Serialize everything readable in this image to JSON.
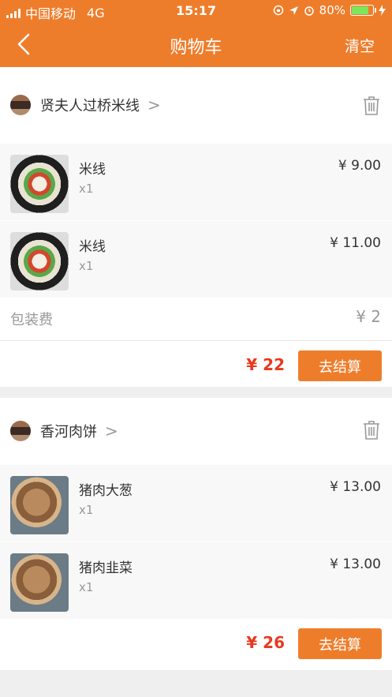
{
  "status_bar": {
    "carrier": "中国移动",
    "network": "4G",
    "time": "15:17",
    "battery": "80%",
    "battery_level": 0.8
  },
  "nav": {
    "title": "购物车",
    "clear_label": "清空"
  },
  "shops": [
    {
      "name": "贤夫人过桥米线",
      "items": [
        {
          "name": "米线",
          "qty": "x1",
          "price": "¥ 9.00"
        },
        {
          "name": "米线",
          "qty": "x1",
          "price": "¥ 11.00"
        }
      ],
      "packaging_label": "包装费",
      "packaging_fee": "¥ 2",
      "total": "¥ 22",
      "checkout_label": "去结算"
    },
    {
      "name": "香河肉饼",
      "items": [
        {
          "name": "猪肉大葱",
          "qty": "x1",
          "price": "¥ 13.00"
        },
        {
          "name": "猪肉韭菜",
          "qty": "x1",
          "price": "¥ 13.00"
        }
      ],
      "total": "¥ 26",
      "checkout_label": "去结算"
    }
  ],
  "colors": {
    "brand": "#ee7d2b",
    "price_red": "#e8391f",
    "battery_green": "#7ce55a"
  }
}
